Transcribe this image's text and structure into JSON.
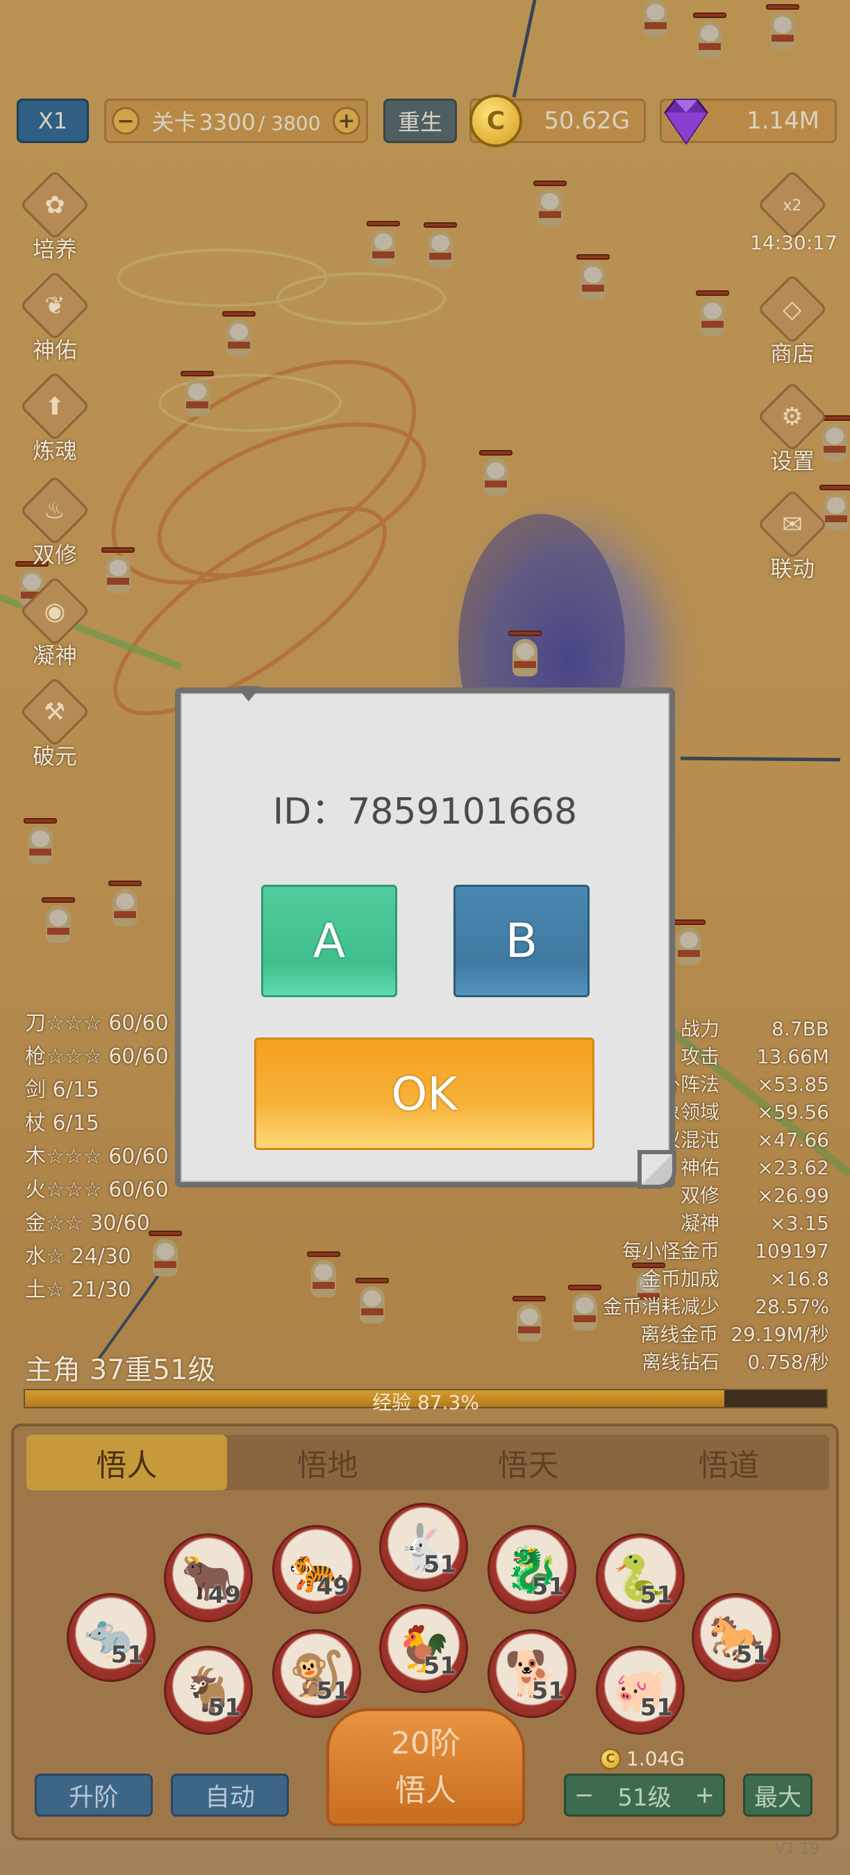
{
  "hud": {
    "speed": "X1",
    "level_prefix": "关卡",
    "level_current": "3300",
    "level_total": "/ 3800",
    "minus": "−",
    "plus": "+",
    "rebirth": "重生",
    "gold": "50.62G",
    "gem": "1.14M",
    "coin_icon": "coin-icon",
    "gem_icon": "gem-icon"
  },
  "left_menu": [
    "培养",
    "神佑",
    "炼魂",
    "双修",
    "凝神",
    "破元"
  ],
  "right_menu": {
    "bonus_label": "x2",
    "timer": "14:30:17",
    "shop": "商店",
    "settings": "设置",
    "linkage": "联动"
  },
  "weapons": [
    "刀☆☆☆ 60/60",
    "枪☆☆☆ 60/60",
    "剑 6/15",
    "杖 6/15",
    "木☆☆☆ 60/60",
    "火☆☆☆ 60/60",
    "金☆☆ 30/60",
    "水☆ 24/30",
    "土☆ 21/30"
  ],
  "stats": [
    {
      "k": "战力",
      "v": "8.7BB"
    },
    {
      "k": "攻击",
      "v": "13.66M"
    },
    {
      "k": "卦阵法",
      "v": "×53.85"
    },
    {
      "k": "象领域",
      "v": "×59.56"
    },
    {
      "k": "仪混沌",
      "v": "×47.66"
    },
    {
      "k": "神佑",
      "v": "×23.62"
    },
    {
      "k": "双修",
      "v": "×26.99"
    },
    {
      "k": "凝神",
      "v": "×3.15"
    },
    {
      "k": "每小怪金币",
      "v": "109197"
    },
    {
      "k": "金币加成",
      "v": "×16.8"
    },
    {
      "k": "金币消耗减少",
      "v": "28.57%"
    },
    {
      "k": "离线金币",
      "v": "29.19M/秒"
    },
    {
      "k": "离线钻石",
      "v": "0.758/秒"
    }
  ],
  "hero": {
    "title": "主角 37重51级",
    "xp_label": "经验 87.3%",
    "xp_fraction": 0.873
  },
  "tabs": [
    "悟人",
    "悟地",
    "悟天",
    "悟道"
  ],
  "zodiac": [
    {
      "icon": "rat-icon",
      "glyph": "🐀",
      "level": "51"
    },
    {
      "icon": "ox-icon",
      "glyph": "🐂",
      "level": "49"
    },
    {
      "icon": "tiger-icon",
      "glyph": "🐅",
      "level": "49"
    },
    {
      "icon": "rabbit-icon",
      "glyph": "🐇",
      "level": "51"
    },
    {
      "icon": "dragon-icon",
      "glyph": "🐉",
      "level": "51"
    },
    {
      "icon": "snake-icon",
      "glyph": "🐍",
      "level": "51"
    },
    {
      "icon": "horse-icon",
      "glyph": "🐎",
      "level": "51"
    },
    {
      "icon": "goat-icon",
      "glyph": "🐐",
      "level": "51"
    },
    {
      "icon": "monkey-icon",
      "glyph": "🐒",
      "level": "51"
    },
    {
      "icon": "rooster-icon",
      "glyph": "🐓",
      "level": "51"
    },
    {
      "icon": "dog-icon",
      "glyph": "🐕",
      "level": "51"
    },
    {
      "icon": "pig-icon",
      "glyph": "🐖",
      "level": "51"
    }
  ],
  "bottom": {
    "upgrade": "升阶",
    "auto": "自动",
    "rank_line1": "20阶",
    "rank_line2": "悟人",
    "cost": "1.04G",
    "stepper_minus": "−",
    "stepper_value": "51级",
    "stepper_plus": "+",
    "max": "最大",
    "version": "V1.19"
  },
  "dialog": {
    "id_text": "ID：7859101668",
    "button_a": "A",
    "button_b": "B",
    "ok": "OK"
  },
  "colors": {
    "button_a": "#3ebf8b",
    "button_b": "#3f7aa1",
    "button_ok": "#f7a823",
    "accent_gold": "#d39b1d"
  }
}
